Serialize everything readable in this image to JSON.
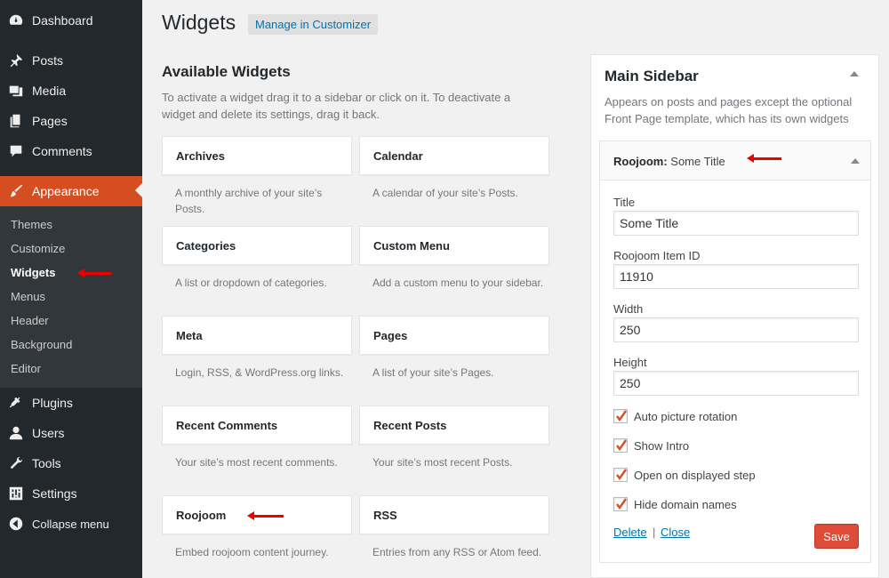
{
  "menu": {
    "items": [
      {
        "label": "Dashboard",
        "icon": "dashboard-icon"
      },
      {
        "label": "Posts",
        "icon": "pin-icon"
      },
      {
        "label": "Media",
        "icon": "media-icon"
      },
      {
        "label": "Pages",
        "icon": "pages-icon"
      },
      {
        "label": "Comments",
        "icon": "comment-icon"
      },
      {
        "label": "Appearance",
        "icon": "brush-icon"
      },
      {
        "label": "Plugins",
        "icon": "plug-icon"
      },
      {
        "label": "Users",
        "icon": "user-icon"
      },
      {
        "label": "Tools",
        "icon": "wrench-icon"
      },
      {
        "label": "Settings",
        "icon": "settings-icon"
      },
      {
        "label": "Collapse menu",
        "icon": "collapse-icon"
      }
    ],
    "submenu": [
      "Themes",
      "Customize",
      "Widgets",
      "Menus",
      "Header",
      "Background",
      "Editor"
    ],
    "accent_color": "#d54e21"
  },
  "header": {
    "title": "Widgets",
    "action": "Manage in Customizer"
  },
  "available": {
    "title": "Available Widgets",
    "description": "To activate a widget drag it to a sidebar or click on it. To deactivate a widget and delete its settings, drag it back.",
    "widgets": [
      {
        "title": "Archives",
        "desc": "A monthly archive of your site’s Posts."
      },
      {
        "title": "Calendar",
        "desc": "A calendar of your site’s Posts."
      },
      {
        "title": "Categories",
        "desc": "A list or dropdown of categories."
      },
      {
        "title": "Custom Menu",
        "desc": "Add a custom menu to your sidebar."
      },
      {
        "title": "Meta",
        "desc": "Login, RSS, & WordPress.org links."
      },
      {
        "title": "Pages",
        "desc": "A list of your site’s Pages."
      },
      {
        "title": "Recent Comments",
        "desc": "Your site’s most recent comments."
      },
      {
        "title": "Recent Posts",
        "desc": "Your site’s most recent Posts."
      },
      {
        "title": "Roojoom",
        "desc": "Embed roojoom content journey."
      },
      {
        "title": "RSS",
        "desc": "Entries from any RSS or Atom feed."
      }
    ]
  },
  "sidebar": {
    "title": "Main Sidebar",
    "description": "Appears on posts and pages except the optional Front Page template, which has its own widgets",
    "widget": {
      "name": "Roojoom:",
      "subtitle": "Some Title",
      "fields": [
        {
          "label": "Title",
          "value": "Some Title"
        },
        {
          "label": "Roojoom Item ID",
          "value": "11910"
        },
        {
          "label": "Width",
          "value": "250"
        },
        {
          "label": "Height",
          "value": "250"
        }
      ],
      "checkboxes": [
        {
          "label": "Auto picture rotation",
          "checked": true
        },
        {
          "label": "Show Intro",
          "checked": true
        },
        {
          "label": "Open on displayed step",
          "checked": true
        },
        {
          "label": "Hide domain names",
          "checked": true
        }
      ],
      "delete_label": "Delete",
      "separator": "|",
      "close_label": "Close",
      "save_label": "Save"
    }
  }
}
